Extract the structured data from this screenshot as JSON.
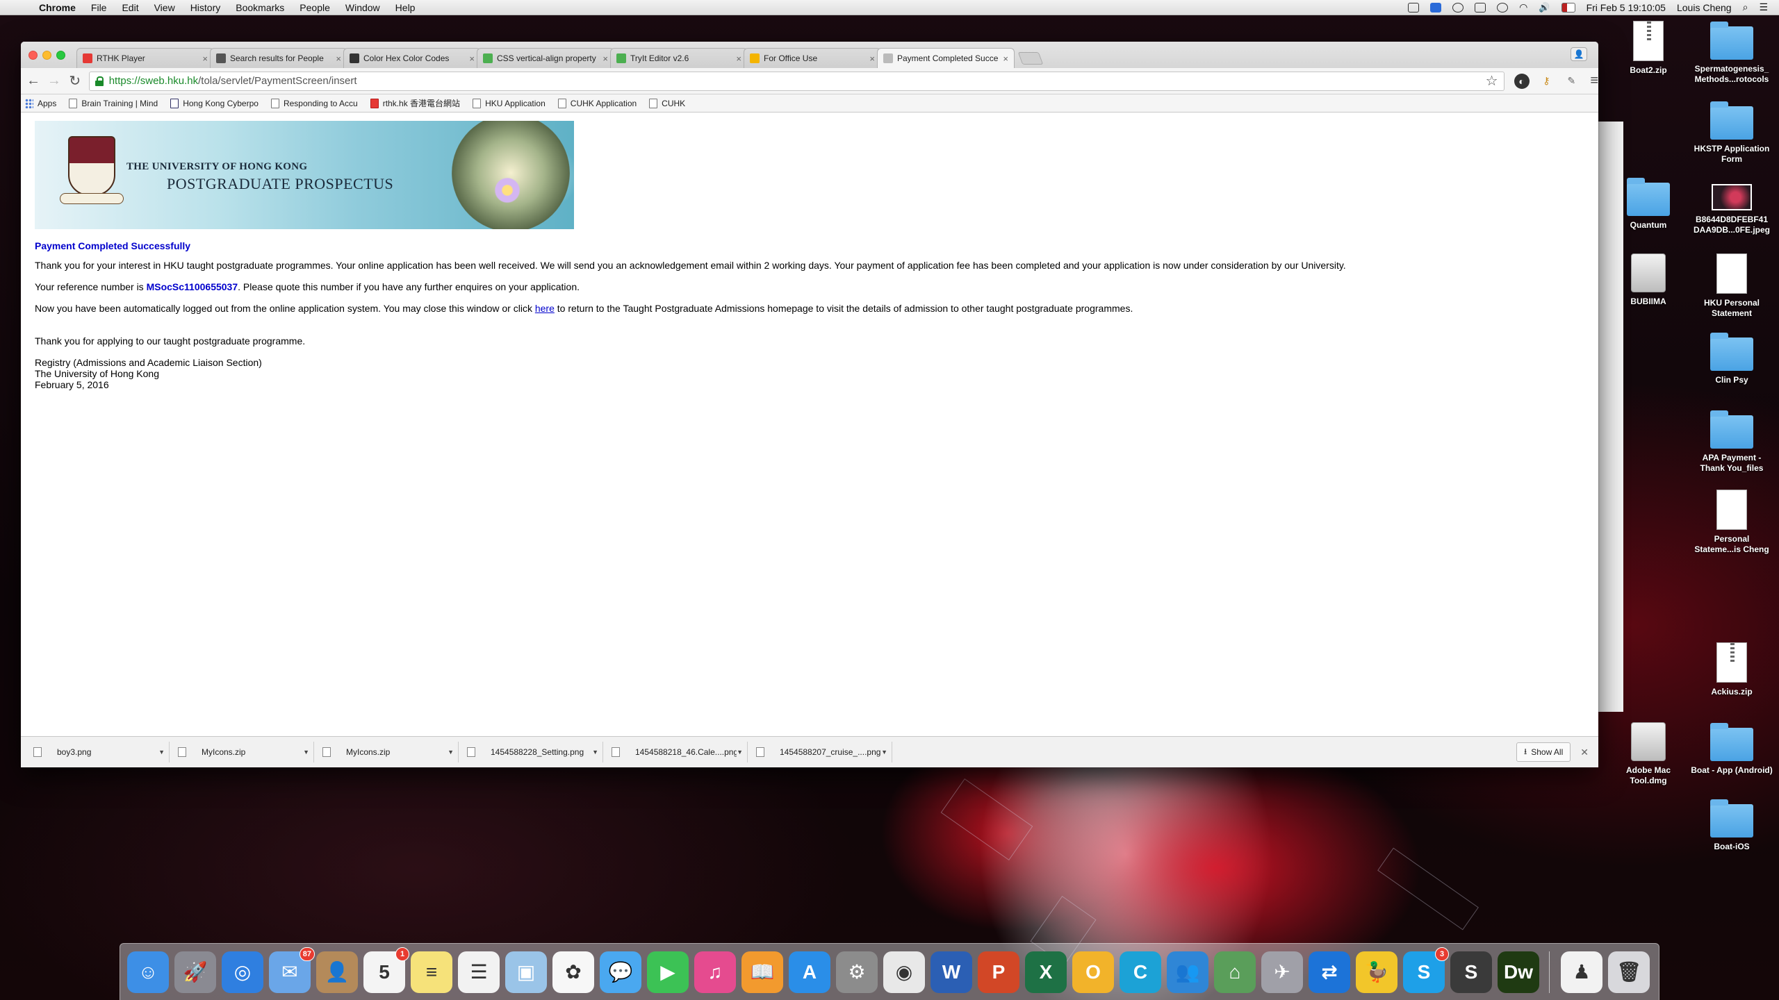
{
  "menubar": {
    "app_name": "Chrome",
    "menus": [
      "File",
      "Edit",
      "View",
      "History",
      "Bookmarks",
      "People",
      "Window",
      "Help"
    ],
    "datetime": "Fri Feb 5  19:10:05",
    "user": "Louis Cheng"
  },
  "browser": {
    "tabs": [
      {
        "label": "RTHK Player",
        "favicon_color": "#e53935"
      },
      {
        "label": "Search results for People",
        "favicon_color": "#555555"
      },
      {
        "label": "Color Hex Color Codes",
        "favicon_color": "#333333"
      },
      {
        "label": "CSS vertical-align property",
        "favicon_color": "#4caf50"
      },
      {
        "label": "TryIt Editor v2.6",
        "favicon_color": "#4caf50"
      },
      {
        "label": "For Office Use",
        "favicon_color": "#f4b400"
      },
      {
        "label": "Payment Completed Succe",
        "favicon_color": "#bbbbbb"
      }
    ],
    "url_scheme_host": "https://sweb.hku.hk",
    "url_path": "/tola/servlet/PaymentScreen/insert",
    "bookmarks": [
      "Apps",
      "Brain Training | Mind",
      "Hong Kong Cyberpo",
      "Responding to Accu",
      "rthk.hk 香港電台網站",
      "HKU Application",
      "CUHK Application",
      "CUHK"
    ]
  },
  "page": {
    "banner_line1": "THE UNIVERSITY OF HONG KONG",
    "banner_line2": "POSTGRADUATE PROSPECTUS",
    "heading": "Payment Completed Successfully",
    "para1": "Thank you for your interest in HKU taught postgraduate programmes. Your online application has been well received. We will send you an acknowledgement email within 2 working days. Your payment of application fee has been completed and your application is now under consideration by our University.",
    "ref_prefix": "Your reference number is ",
    "ref_number": "MSocSc1100655037",
    "ref_suffix": ". Please quote this number if you have any further enquires on your application.",
    "logout_prefix": "Now you have been automatically logged out from the online application system. You may close this window or click ",
    "logout_link": "here",
    "logout_suffix": " to return to the Taught Postgraduate Admissions homepage to visit the details of admission to other taught postgraduate programmes.",
    "thanks": "Thank you for applying to our taught postgraduate programme.",
    "sig_line1": "Registry (Admissions and Academic Liaison Section)",
    "sig_line2": "The University of Hong Kong",
    "sig_line3": "February 5, 2016"
  },
  "downloads": {
    "items": [
      "boy3.png",
      "MyIcons.zip",
      "MyIcons.zip",
      "1454588228_Setting.png",
      "1454588218_46.Cale....png",
      "1454588207_cruise_....png"
    ],
    "show_all": "Show All"
  },
  "desktop": {
    "icons": [
      {
        "label": "Boat2.zip",
        "type": "zip"
      },
      {
        "label": "Spermatogenesis_ Methods...rotocols",
        "type": "folder"
      },
      {
        "label": "HKSTP Application Form",
        "type": "folder"
      },
      {
        "label": "Quantum",
        "type": "folder"
      },
      {
        "label": "B8644D8DFEBF41 DAA9DB...0FE.jpeg",
        "type": "image"
      },
      {
        "label": "BUBIIMA",
        "type": "disk"
      },
      {
        "label": "HKU Personal Statement",
        "type": "doc"
      },
      {
        "label": "Clin Psy",
        "type": "folder"
      },
      {
        "label": "APA Payment - Thank You_files",
        "type": "folder"
      },
      {
        "label": "Personal Stateme...is Cheng",
        "type": "docx"
      },
      {
        "label": "Ackius.zip",
        "type": "zip"
      },
      {
        "label": "Adobe Mac Tool.dmg",
        "type": "disk"
      },
      {
        "label": "Boat - App (Android)",
        "type": "folder"
      },
      {
        "label": "Boat-iOS",
        "type": "folder"
      }
    ]
  },
  "dock": {
    "apps": [
      {
        "name": "Finder",
        "color": "#3d8fe6",
        "glyph": "☺"
      },
      {
        "name": "Launchpad",
        "color": "#8a8a92",
        "glyph": "🚀"
      },
      {
        "name": "Safari",
        "color": "#2f7fe0",
        "glyph": "◎"
      },
      {
        "name": "Mail",
        "color": "#6aa6e8",
        "glyph": "✉",
        "badge": "87"
      },
      {
        "name": "Contacts",
        "color": "#b48a5a",
        "glyph": "👤"
      },
      {
        "name": "Calendar",
        "color": "#f4f4f4",
        "glyph": "5",
        "badge": "1"
      },
      {
        "name": "Notes",
        "color": "#f6e27a",
        "glyph": "≡"
      },
      {
        "name": "Reminders",
        "color": "#f2f2f2",
        "glyph": "☰"
      },
      {
        "name": "Preview",
        "color": "#9ac4e8",
        "glyph": "▣"
      },
      {
        "name": "Photos",
        "color": "#f7f7f7",
        "glyph": "✿"
      },
      {
        "name": "Messages",
        "color": "#4aa8f0",
        "glyph": "💬"
      },
      {
        "name": "FaceTime",
        "color": "#3cc255",
        "glyph": "▶"
      },
      {
        "name": "iTunes",
        "color": "#e54b8f",
        "glyph": "♫"
      },
      {
        "name": "iBooks",
        "color": "#f29a2e",
        "glyph": "📖"
      },
      {
        "name": "App Store",
        "color": "#2a8ee8",
        "glyph": "A"
      },
      {
        "name": "System Preferences",
        "color": "#8c8c8c",
        "glyph": "⚙"
      },
      {
        "name": "Chrome",
        "color": "#e8e8e8",
        "glyph": "◉"
      },
      {
        "name": "Word",
        "color": "#2b5fb4",
        "glyph": "W"
      },
      {
        "name": "PowerPoint",
        "color": "#d24726",
        "glyph": "P"
      },
      {
        "name": "Excel",
        "color": "#1e7145",
        "glyph": "X"
      },
      {
        "name": "Outlook",
        "color": "#f2b32a",
        "glyph": "O"
      },
      {
        "name": "Cisco",
        "color": "#1ca2d6",
        "glyph": "C"
      },
      {
        "name": "Lync",
        "color": "#2f86d6",
        "glyph": "👥"
      },
      {
        "name": "Network",
        "color": "#5a9e5a",
        "glyph": "⌂"
      },
      {
        "name": "Utility",
        "color": "#a0a0a8",
        "glyph": "✈"
      },
      {
        "name": "TeamViewer",
        "color": "#1c73d8",
        "glyph": "⇄"
      },
      {
        "name": "Cyberduck",
        "color": "#f2c62a",
        "glyph": "🦆"
      },
      {
        "name": "Skype",
        "color": "#1ea0e8",
        "glyph": "S",
        "badge": "3"
      },
      {
        "name": "Sublime",
        "color": "#3a3a3a",
        "glyph": "S"
      },
      {
        "name": "Dreamweaver",
        "color": "#1f3a12",
        "glyph": "Dw"
      },
      {
        "name": "Downloads",
        "color": "#f2f2f2",
        "glyph": "♟"
      },
      {
        "name": "Trash",
        "color": "#d8d8dc",
        "glyph": "🗑"
      }
    ]
  }
}
